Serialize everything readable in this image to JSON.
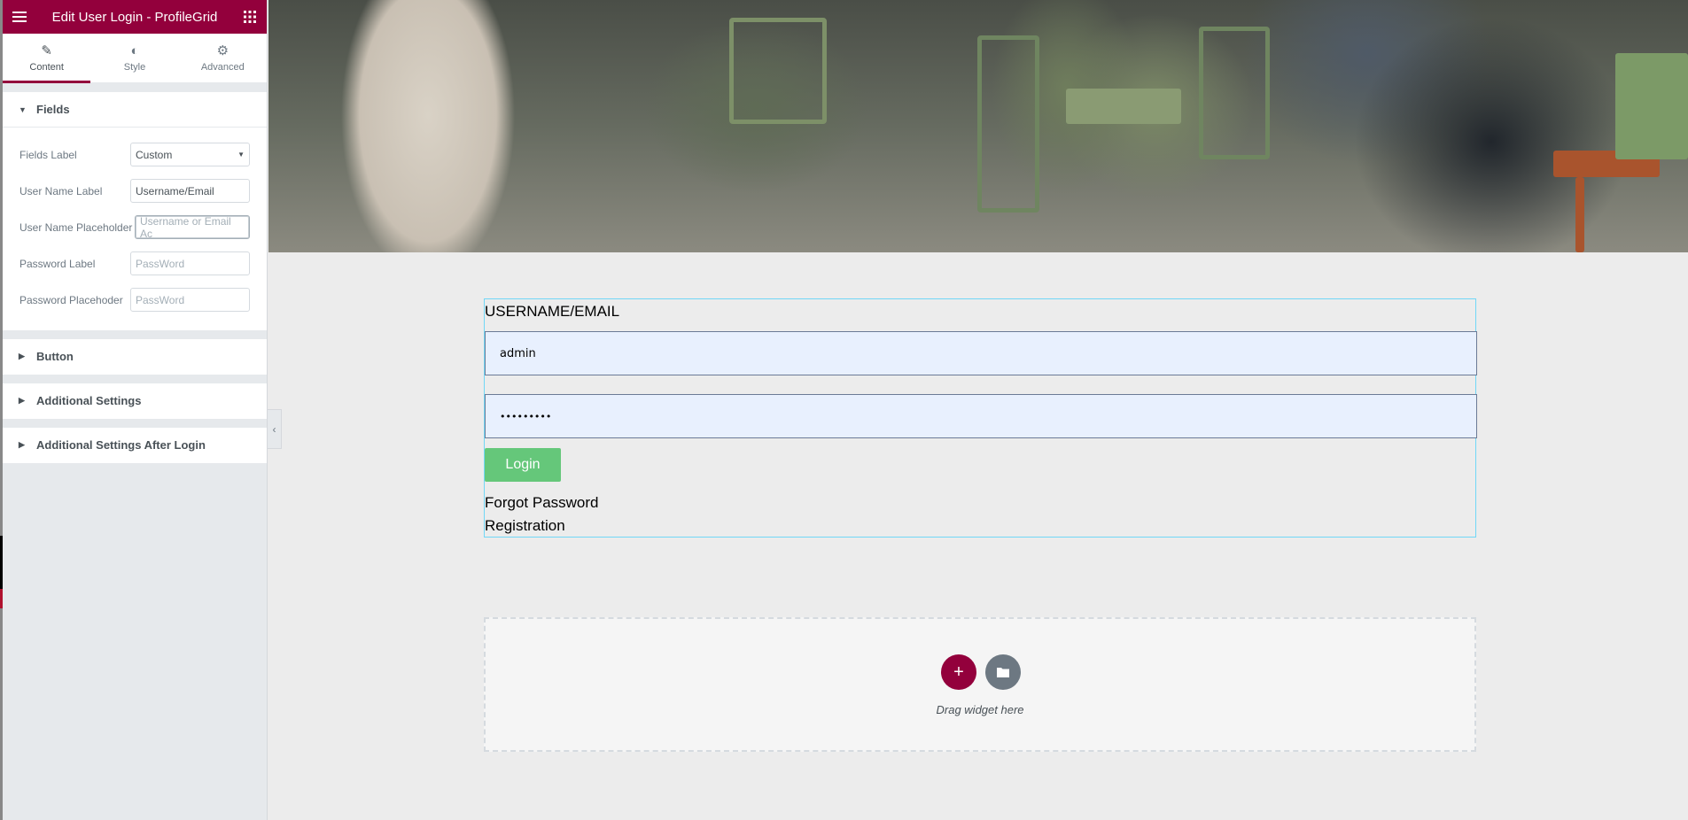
{
  "panel": {
    "title": "Edit User Login - ProfileGrid",
    "tabs": [
      {
        "label": "Content",
        "icon": "pencil-icon"
      },
      {
        "label": "Style",
        "icon": "half-circle-icon"
      },
      {
        "label": "Advanced",
        "icon": "gear-icon"
      }
    ],
    "sections": {
      "fields": {
        "title": "Fields",
        "controls": {
          "fields_label": {
            "label": "Fields Label",
            "value": "Custom"
          },
          "user_name_label": {
            "label": "User Name Label",
            "value": "Username/Email"
          },
          "user_name_placeholder": {
            "label": "User Name Placeholder",
            "placeholder": "Username or Email Ac"
          },
          "password_label": {
            "label": "Password Label",
            "placeholder": "PassWord"
          },
          "password_placeholder": {
            "label": "Password Placehoder",
            "placeholder": "PassWord"
          }
        }
      },
      "button": {
        "title": "Button"
      },
      "additional": {
        "title": "Additional Settings"
      },
      "additional_after": {
        "title": "Additional Settings After Login"
      }
    }
  },
  "colors": {
    "brand": "#93003c",
    "login_button": "#65c77a",
    "widget_outline": "#71d7f7"
  },
  "login_form": {
    "username_label": "USERNAME/EMAIL",
    "username_value": "admin",
    "password_value": "•••••••••",
    "login_button": "Login",
    "forgot_link": "Forgot Password",
    "registration_link": "Registration"
  },
  "dropzone": {
    "text": "Drag widget here"
  }
}
